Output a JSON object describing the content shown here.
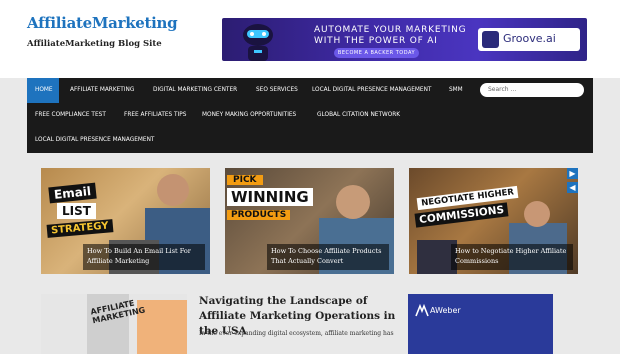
{
  "site": {
    "title": "AffiliateMarketing",
    "tagline": "AffiliateMarketing Blog Site"
  },
  "banner": {
    "line1": "AUTOMATE YOUR MARKETING",
    "line2": "WITH THE POWER OF AI",
    "cta": "BECOME A BACKER TODAY",
    "brand": "Groove.ai"
  },
  "nav": {
    "items": [
      "HOME",
      "AFFILIATE MARKETING",
      "DIGITAL MARKETING CENTER",
      "SEO SERVICES",
      "LOCAL DIGITAL PRESENCE MANAGEMENT",
      "SMM",
      "FREE COMPLIANCE TEST",
      "FREE AFFILIATES TIPS",
      "MONEY MAKING OPPORTUNITIES",
      "GLOBAL CITATION NETWORK",
      "LOCAL DIGITAL PRESENCE MANAGEMENT"
    ],
    "search_placeholder": "Search ..."
  },
  "slider": {
    "cards": [
      {
        "caption": "How To Build An Email List For Affiliate Marketing",
        "image_text": [
          "Email",
          "LIST",
          "STRATEGY"
        ]
      },
      {
        "caption": "How To Choose Affiliate Products That Actually Convert",
        "image_text": [
          "PICK",
          "WINNING",
          "PRODUCTS"
        ]
      },
      {
        "caption": "How to Negotiate Higher Affiliate Commissions",
        "image_text": [
          "NEGOTIATE HIGHER",
          "COMMISSIONS"
        ]
      }
    ],
    "next_icon": "arrow-right-icon",
    "prev_icon": "arrow-left-icon"
  },
  "featured": {
    "image_text": [
      "AFFILIATE",
      "MARKETING"
    ],
    "title": "Navigating the Landscape of Affiliate Marketing Operations in the USA",
    "excerpt": "In the ever-expanding digital ecosystem, affiliate marketing has"
  },
  "sidebar": {
    "ad_brand": "AWeber"
  },
  "colors": {
    "accent": "#1e73be",
    "nav_bg": "#1a1a1a"
  }
}
